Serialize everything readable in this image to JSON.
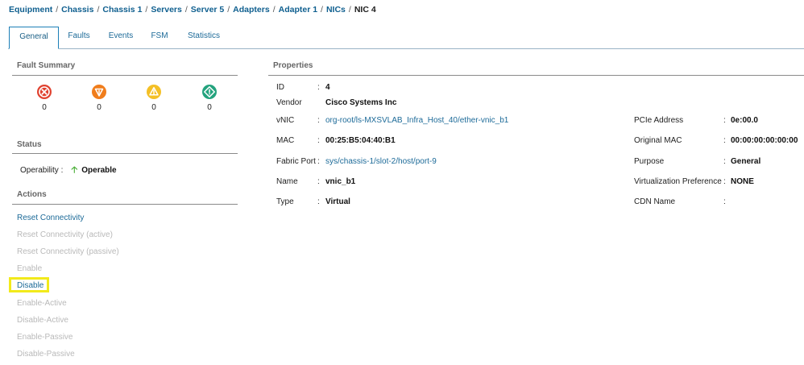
{
  "breadcrumb": [
    {
      "label": "Equipment"
    },
    {
      "label": "Chassis"
    },
    {
      "label": "Chassis 1"
    },
    {
      "label": "Servers"
    },
    {
      "label": "Server 5"
    },
    {
      "label": "Adapters"
    },
    {
      "label": "Adapter 1"
    },
    {
      "label": "NICs"
    },
    {
      "label": "NIC 4"
    }
  ],
  "tabs": [
    {
      "label": "General",
      "active": true
    },
    {
      "label": "Faults"
    },
    {
      "label": "Events"
    },
    {
      "label": "FSM"
    },
    {
      "label": "Statistics"
    }
  ],
  "fault_summary": {
    "title": "Fault Summary",
    "items": [
      {
        "icon": "critical-fault-icon",
        "color": "#e0412f",
        "count": "0"
      },
      {
        "icon": "major-fault-icon",
        "color": "#f07d1c",
        "count": "0"
      },
      {
        "icon": "minor-fault-icon",
        "color": "#f4c026",
        "count": "0"
      },
      {
        "icon": "warning-fault-icon",
        "color": "#24a37e",
        "count": "0"
      }
    ]
  },
  "status": {
    "title": "Status",
    "operability_label": "Operability :",
    "operability_value": "Operable",
    "operability_icon": "up-arrow-icon",
    "operability_color": "#4caf3a"
  },
  "actions": {
    "title": "Actions",
    "items": [
      {
        "label": "Reset Connectivity",
        "enabled": true
      },
      {
        "label": "Reset Connectivity (active)",
        "enabled": false
      },
      {
        "label": "Reset Connectivity (passive)",
        "enabled": false
      },
      {
        "label": "Enable",
        "enabled": false
      },
      {
        "label": "Disable",
        "enabled": true,
        "highlighted": true
      },
      {
        "label": "Enable-Active",
        "enabled": false
      },
      {
        "label": "Disable-Active",
        "enabled": false
      },
      {
        "label": "Enable-Passive",
        "enabled": false
      },
      {
        "label": "Disable-Passive",
        "enabled": false
      }
    ]
  },
  "properties": {
    "title": "Properties",
    "left": [
      {
        "label": "ID",
        "value": "4",
        "style": "bold"
      },
      {
        "label": "Vendor",
        "value": "Cisco Systems Inc",
        "style": "bold"
      },
      {
        "label": "vNIC",
        "value": "org-root/ls-MXSVLAB_Infra_Host_40/ether-vnic_b1",
        "style": "link"
      },
      {
        "label": "MAC",
        "value": "00:25:B5:04:40:B1",
        "style": "bold"
      },
      {
        "label": "Fabric Port",
        "value": "sys/chassis-1/slot-2/host/port-9",
        "style": "link"
      },
      {
        "label": "Name",
        "value": "vnic_b1",
        "style": "bold"
      },
      {
        "label": "Type",
        "value": "Virtual",
        "style": "bold"
      }
    ],
    "right": [
      {
        "label": "PCIe Address",
        "value": "0e:00.0",
        "style": "bold"
      },
      {
        "label": "Original MAC",
        "value": "00:00:00:00:00:00",
        "style": "bold"
      },
      {
        "label": "Purpose",
        "value": "General",
        "style": "bold"
      },
      {
        "label": "Virtualization Preference",
        "value": "NONE",
        "style": "bold"
      },
      {
        "label": "CDN Name",
        "value": "",
        "style": "bold"
      }
    ]
  },
  "colors": {
    "link": "#1c6a98",
    "highlight": "#f2ea1b"
  }
}
